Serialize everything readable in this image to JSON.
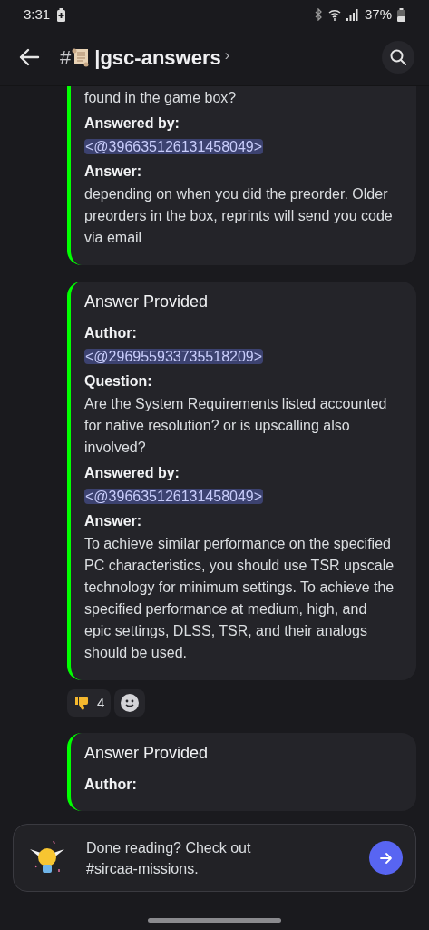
{
  "status_bar": {
    "time": "3:31",
    "battery": "37%"
  },
  "header": {
    "hash": "#",
    "title": "|gsc-answers",
    "chevron": "›"
  },
  "cards": [
    {
      "lines": [
        {
          "kind": "text",
          "text": "found in the game box?"
        },
        {
          "kind": "label",
          "text": "Answered by:"
        },
        {
          "kind": "mention",
          "text": "<@396635126131458049>"
        },
        {
          "kind": "label",
          "text": "Answer:"
        },
        {
          "kind": "text",
          "text": "depending on when you did the preorder. Older preorders in the box, reprints will send you code via email"
        }
      ]
    },
    {
      "title": "Answer Provided",
      "lines": [
        {
          "kind": "label",
          "text": "Author:"
        },
        {
          "kind": "mention",
          "text": "<@296955933735518209>"
        },
        {
          "kind": "label",
          "text": "Question:"
        },
        {
          "kind": "text",
          "text": "Are the System Requirements listed accounted for native resolution? or is upscalling also involved?"
        },
        {
          "kind": "label",
          "text": "Answered by:"
        },
        {
          "kind": "mention",
          "text": "<@396635126131458049>"
        },
        {
          "kind": "label",
          "text": "Answer:"
        },
        {
          "kind": "text",
          "text": "To achieve similar performance on the specified PC characteristics, you should use TSR upscale technology for minimum settings. To achieve the specified performance at medium, high, and epic settings, DLSS, TSR, and their analogs should be used."
        }
      ],
      "reactions": [
        {
          "count": "4"
        }
      ]
    },
    {
      "title": "Answer Provided",
      "lines": [
        {
          "kind": "label",
          "text": "Author:"
        }
      ]
    }
  ],
  "banner": {
    "text": "Done reading? Check out #sircaa-missions."
  }
}
